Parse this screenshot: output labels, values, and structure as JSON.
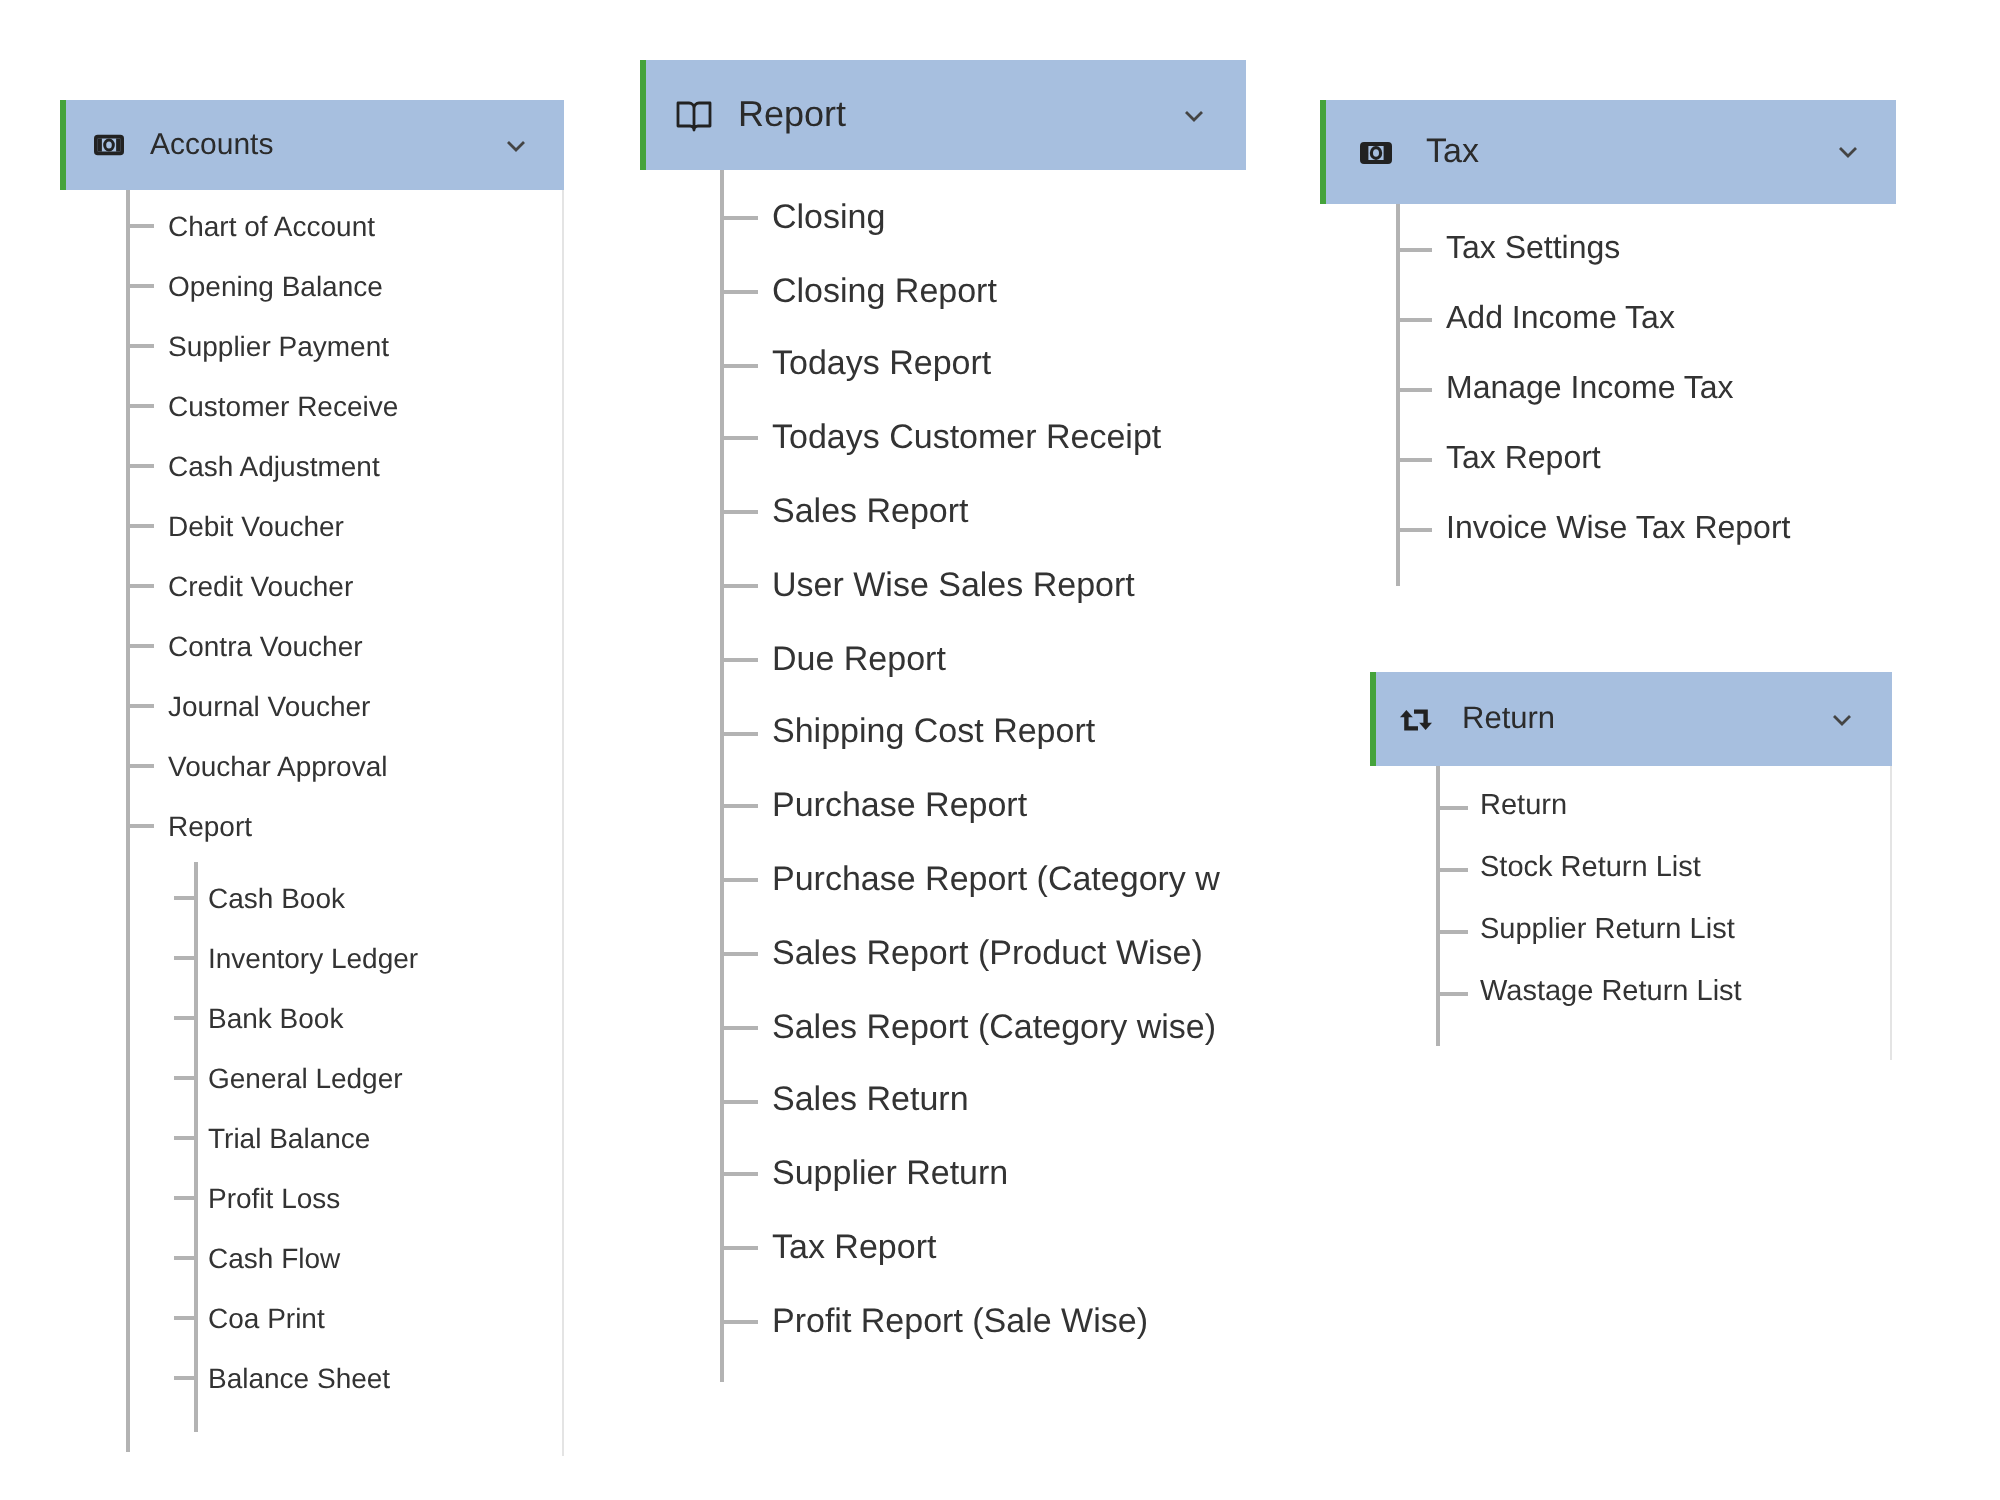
{
  "menus": [
    {
      "title": "Accounts",
      "expanded": true,
      "items": [
        {
          "label": "Chart of Account"
        },
        {
          "label": "Opening Balance"
        },
        {
          "label": "Supplier Payment"
        },
        {
          "label": "Customer Receive"
        },
        {
          "label": "Cash Adjustment"
        },
        {
          "label": "Debit Voucher"
        },
        {
          "label": "Credit Voucher"
        },
        {
          "label": "Contra Voucher"
        },
        {
          "label": "Journal Voucher"
        },
        {
          "label": "Vouchar Approval"
        },
        {
          "label": "Report",
          "children": [
            {
              "label": "Cash Book"
            },
            {
              "label": "Inventory Ledger"
            },
            {
              "label": "Bank Book"
            },
            {
              "label": "General Ledger"
            },
            {
              "label": "Trial Balance"
            },
            {
              "label": "Profit Loss"
            },
            {
              "label": "Cash Flow"
            },
            {
              "label": "Coa Print"
            },
            {
              "label": "Balance Sheet"
            }
          ]
        }
      ]
    },
    {
      "title": "Report",
      "expanded": true,
      "items": [
        {
          "label": "Closing"
        },
        {
          "label": "Closing Report"
        },
        {
          "label": "Todays Report"
        },
        {
          "label": "Todays Customer Receipt"
        },
        {
          "label": "Sales Report"
        },
        {
          "label": "User Wise Sales Report"
        },
        {
          "label": "Due Report"
        },
        {
          "label": "Shipping Cost Report"
        },
        {
          "label": "Purchase Report"
        },
        {
          "label": "Purchase Report (Category w"
        },
        {
          "label": "Sales Report (Product Wise)"
        },
        {
          "label": "Sales Report (Category wise)"
        },
        {
          "label": "Sales Return"
        },
        {
          "label": "Supplier Return"
        },
        {
          "label": "Tax Report"
        },
        {
          "label": "Profit Report (Sale Wise)"
        }
      ]
    },
    {
      "title": "Tax",
      "expanded": true,
      "items": [
        {
          "label": "Tax Settings"
        },
        {
          "label": "Add Income Tax"
        },
        {
          "label": "Manage Income Tax"
        },
        {
          "label": "Tax Report"
        },
        {
          "label": "Invoice Wise Tax Report"
        }
      ]
    },
    {
      "title": "Return",
      "expanded": true,
      "items": [
        {
          "label": "Return"
        },
        {
          "label": "Stock Return List"
        },
        {
          "label": "Supplier Return List"
        },
        {
          "label": "Wastage Return List"
        }
      ]
    }
  ]
}
